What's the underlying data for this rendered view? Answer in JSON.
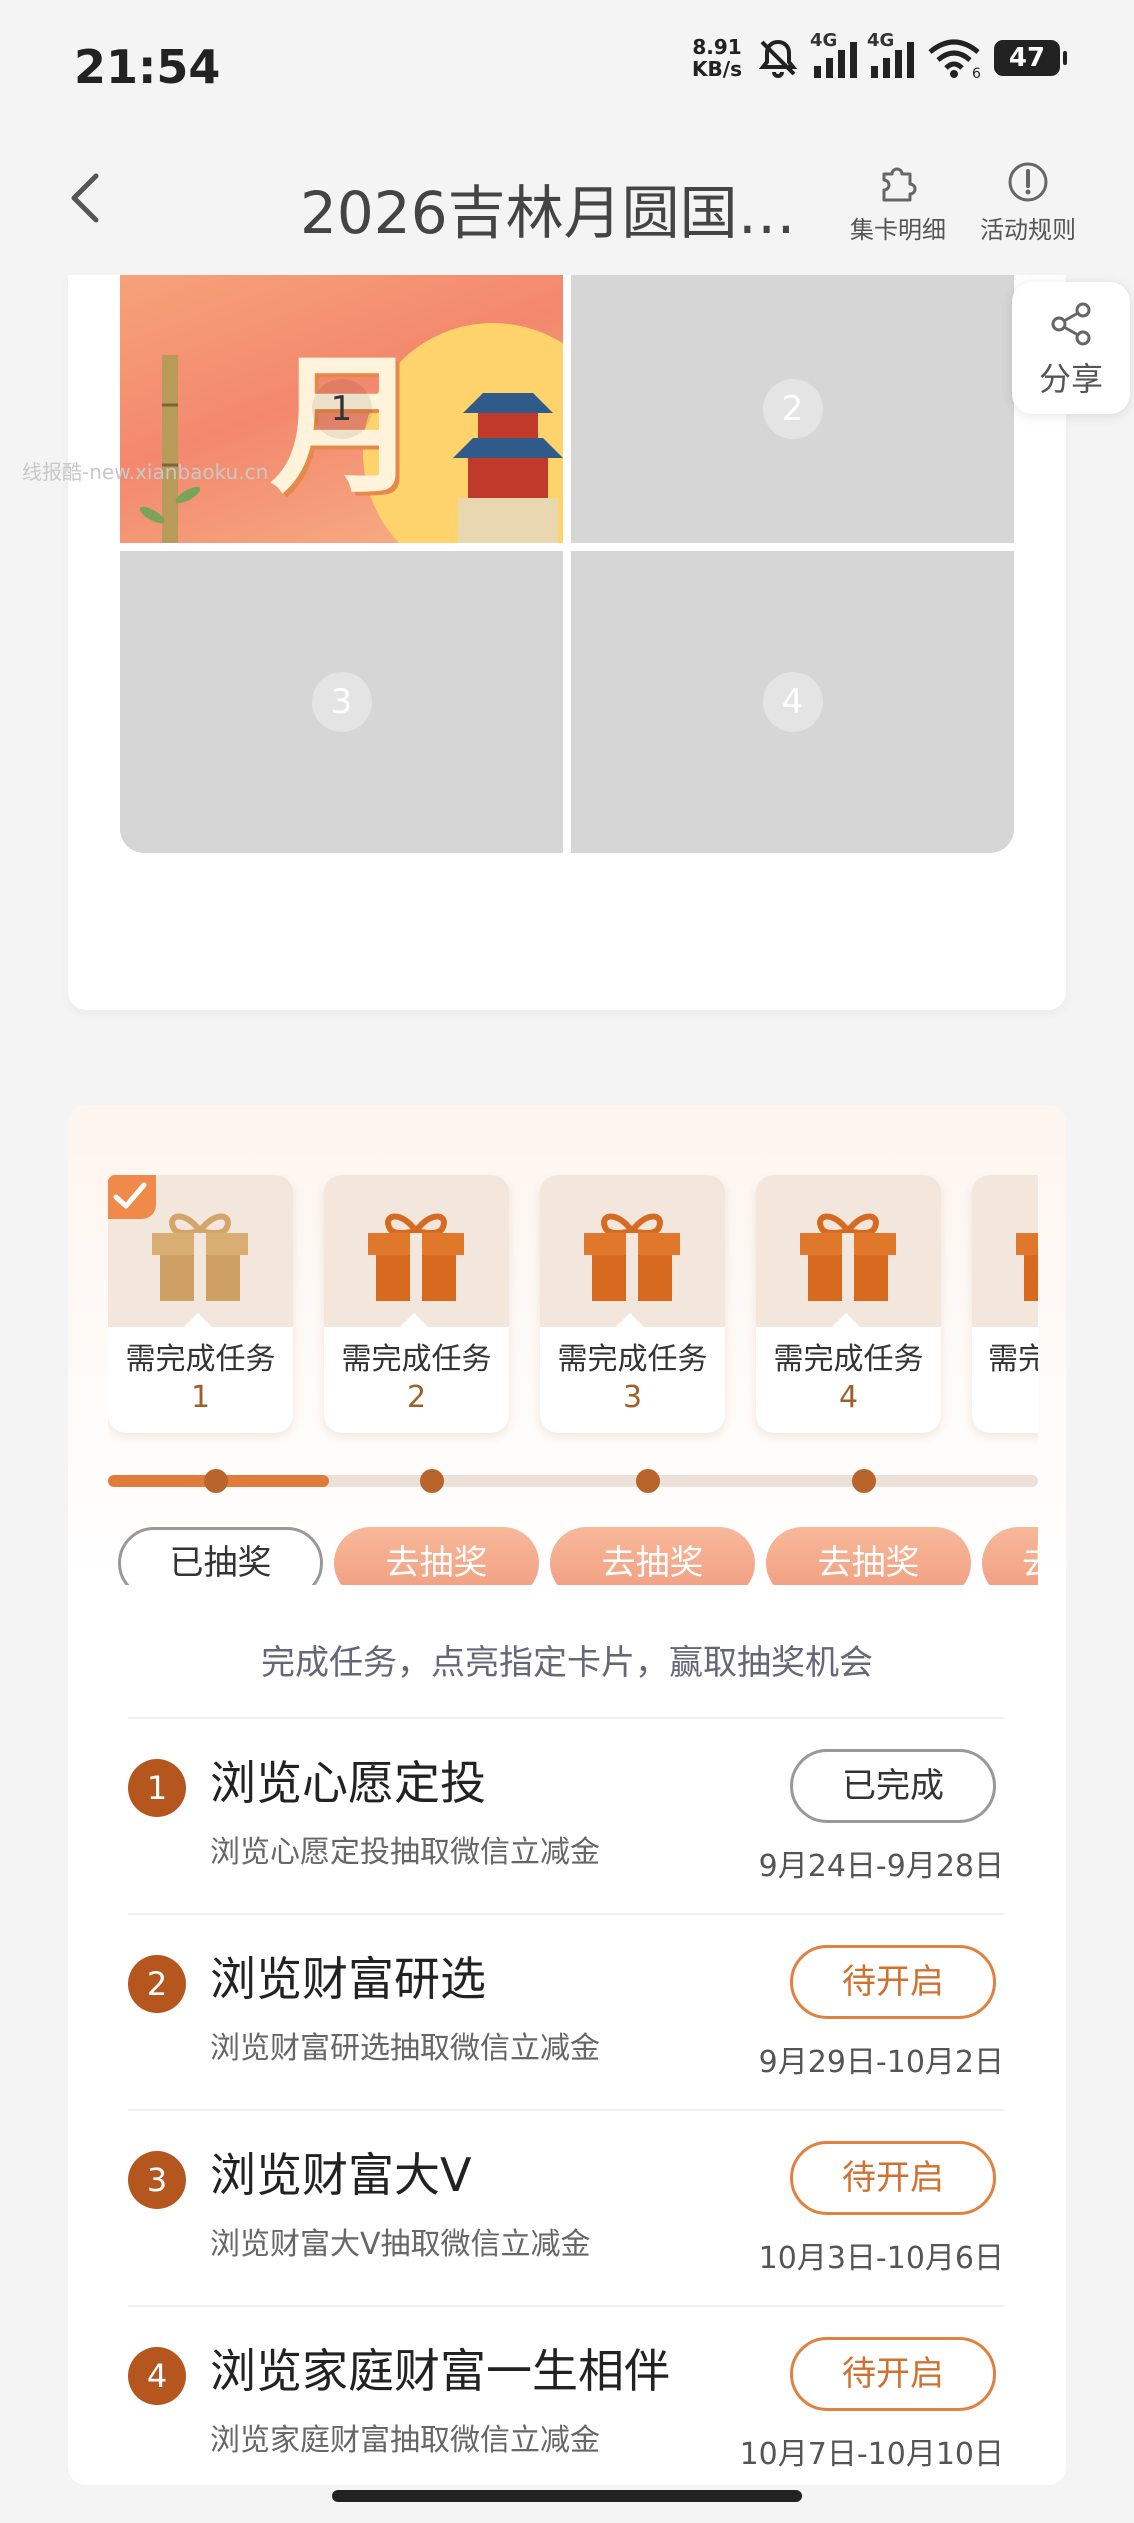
{
  "status_bar": {
    "time": "21:54",
    "net_speed_value": "8.91",
    "net_speed_unit": "KB/s",
    "sim1": "4G",
    "sim2": "4G",
    "wifi_label": "6",
    "battery": "47"
  },
  "header": {
    "title": "2026吉林月圆国…",
    "card_detail_label": "集卡明细",
    "rules_label": "活动规则"
  },
  "share": {
    "label": "分享"
  },
  "watermark": "线报酷-new.xianbaoku.cn",
  "puzzle": {
    "pieces": [
      {
        "number": "1",
        "unlocked": true,
        "art_char": "月"
      },
      {
        "number": "2",
        "unlocked": false
      },
      {
        "number": "3",
        "unlocked": false
      },
      {
        "number": "4",
        "unlocked": false
      }
    ]
  },
  "prizes": [
    {
      "label": "需完成任务",
      "task": "1",
      "checked": true
    },
    {
      "label": "需完成任务",
      "task": "2",
      "checked": false
    },
    {
      "label": "需完成任务",
      "task": "3",
      "checked": false
    },
    {
      "label": "需完成任务",
      "task": "4",
      "checked": false
    },
    {
      "label": "需完",
      "task": "",
      "checked": false
    }
  ],
  "progress": {
    "completed_fraction": 0.25
  },
  "draw_buttons": [
    {
      "label": "已抽奖",
      "state": "done"
    },
    {
      "label": "去抽奖",
      "state": "go"
    },
    {
      "label": "去抽奖",
      "state": "go"
    },
    {
      "label": "去抽奖",
      "state": "go"
    },
    {
      "label": "去",
      "state": "go"
    }
  ],
  "hint": "完成任务，点亮指定卡片，赢取抽奖机会",
  "tasks": [
    {
      "num": "1",
      "title": "浏览心愿定投",
      "subtitle": "浏览心愿定投抽取微信立减金",
      "button": "已完成",
      "state": "done",
      "date": "9月24日-9月28日"
    },
    {
      "num": "2",
      "title": "浏览财富研选",
      "subtitle": "浏览财富研选抽取微信立减金",
      "button": "待开启",
      "state": "wait",
      "date": "9月29日-10月2日"
    },
    {
      "num": "3",
      "title": "浏览财富大V",
      "subtitle": "浏览财富大V抽取微信立减金",
      "button": "待开启",
      "state": "wait",
      "date": "10月3日-10月6日"
    },
    {
      "num": "4",
      "title": "浏览家庭财富一生相伴",
      "subtitle": "浏览家庭财富抽取微信立减金",
      "button": "待开启",
      "state": "wait",
      "date": "10月7日-10月10日"
    }
  ],
  "colors": {
    "accent": "#e07b3a",
    "task_number_bg": "#b5561f",
    "locked_piece": "#d6d6d6"
  }
}
